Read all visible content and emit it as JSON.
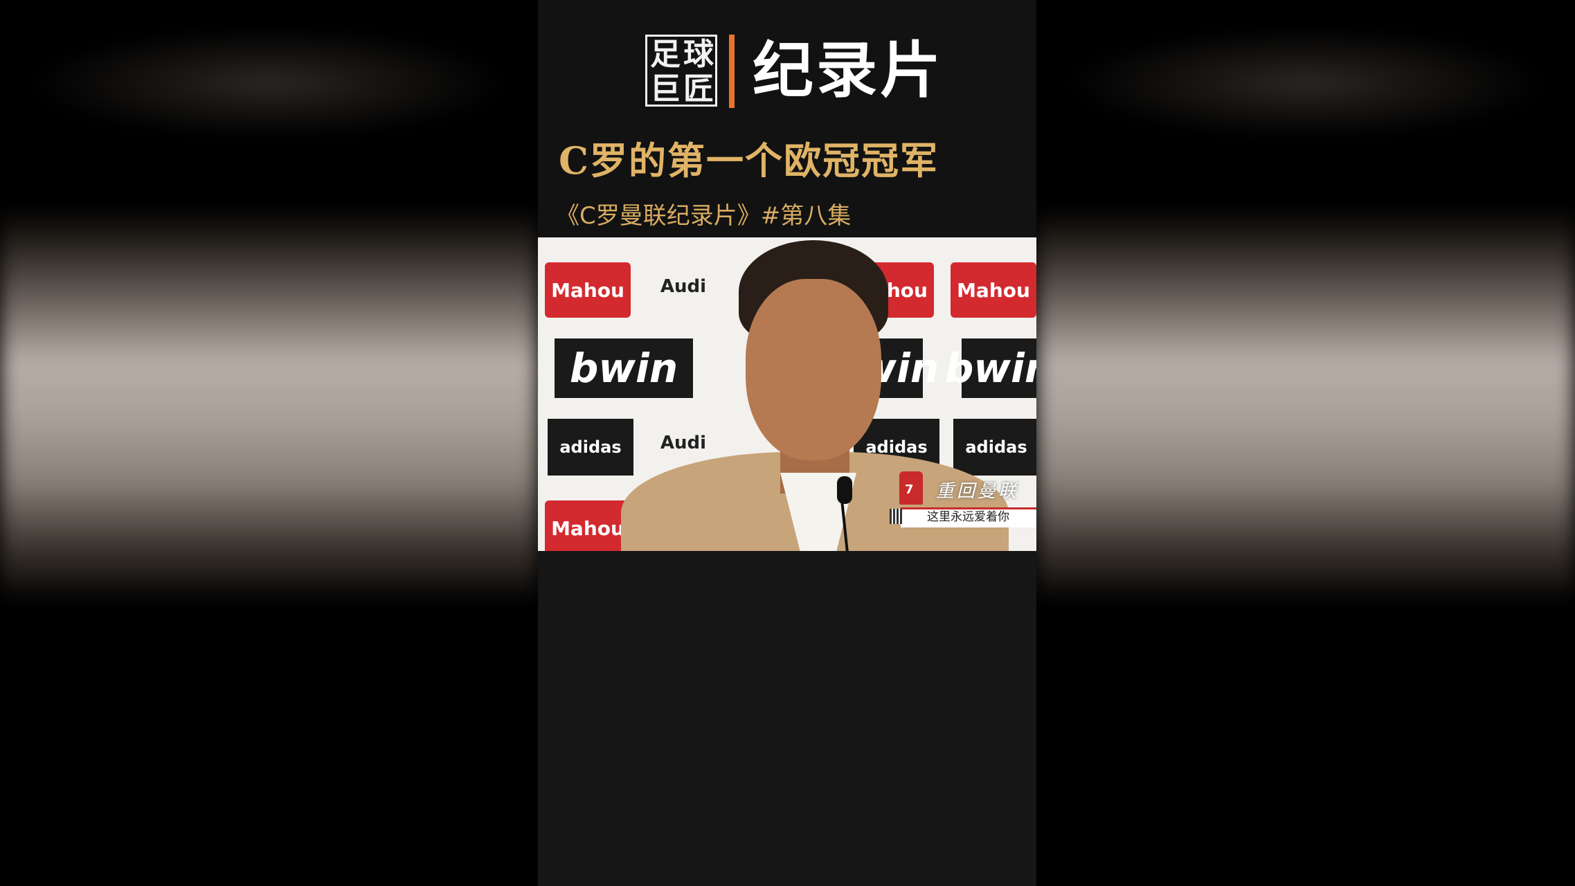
{
  "logo": {
    "chars": [
      "足",
      "球",
      "巨",
      "匠"
    ]
  },
  "header": {
    "doc_title": "纪录片",
    "headline": "C罗的第一个欧冠冠军",
    "subtitle": "《C罗曼联纪录片》#第八集"
  },
  "video": {
    "sponsors": {
      "mahou": "Mahou",
      "audi": "Audi",
      "bwin": "bwin",
      "adidas": "adidas"
    },
    "overlay": {
      "title": "重回曼联",
      "caption": "这里永远爱着你",
      "jersey_number": "7"
    }
  },
  "colors": {
    "accent_orange": "#e8742b",
    "headline_gold": "#e0b366",
    "background": "#121212"
  }
}
